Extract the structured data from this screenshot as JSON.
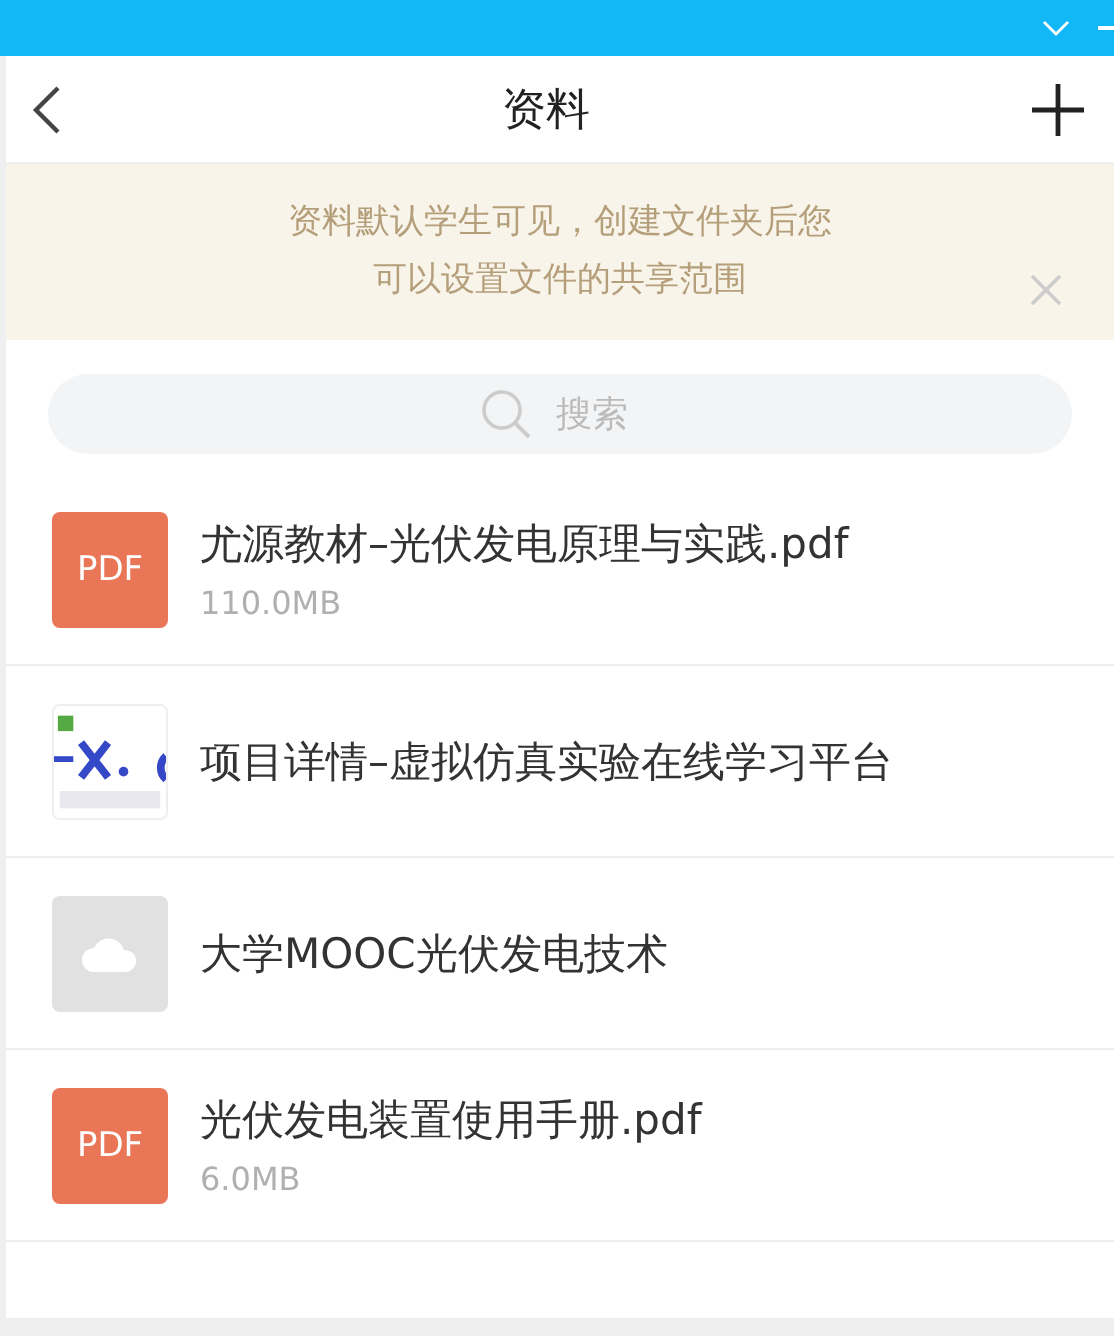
{
  "header": {
    "title": "资料"
  },
  "notice": {
    "lines": [
      "资料默认学生可见，创建文件夹后您",
      "可以设置文件的共享范围"
    ]
  },
  "search": {
    "placeholder": "搜索"
  },
  "files": [
    {
      "kind": "pdf",
      "badge": "PDF",
      "name": "尤源教材–光伏发电原理与实践.pdf",
      "size": "110.0MB"
    },
    {
      "kind": "picture",
      "name": "项目详情–虚拟仿真实验在线学习平台"
    },
    {
      "kind": "cloud",
      "name": "大学MOOC光伏发电技术"
    },
    {
      "kind": "pdf",
      "badge": "PDF",
      "name": "光伏发电装置使用手册.pdf",
      "size": "6.0MB"
    }
  ]
}
